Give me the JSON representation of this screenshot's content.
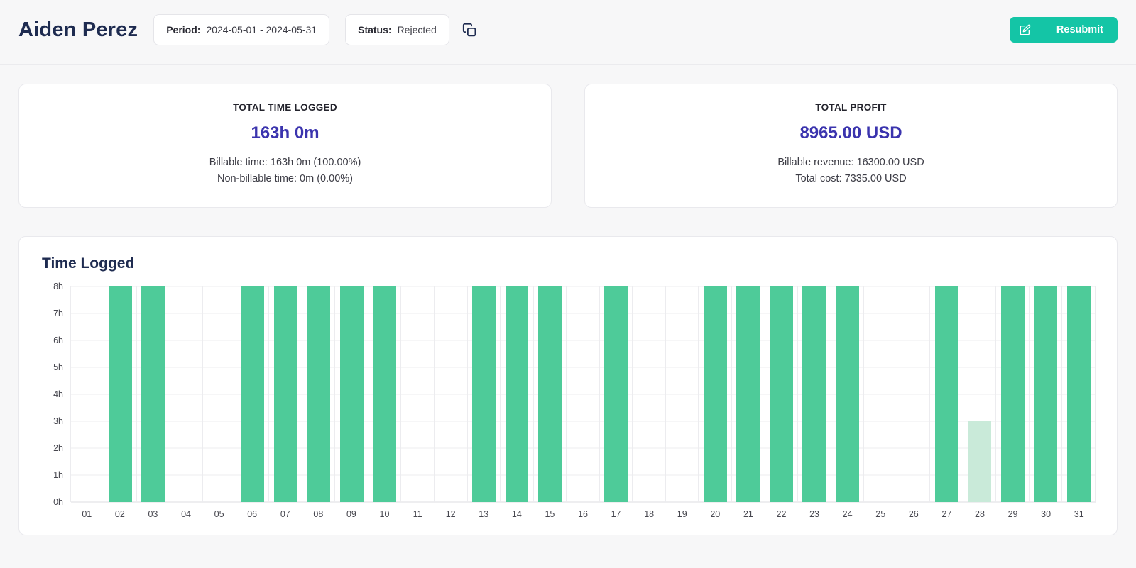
{
  "header": {
    "title": "Aiden Perez",
    "period_label": "Period:",
    "period_value": "2024-05-01 - 2024-05-31",
    "status_label": "Status:",
    "status_value": "Rejected",
    "resubmit_label": "Resubmit"
  },
  "cards": [
    {
      "title": "TOTAL TIME LOGGED",
      "value": "163h 0m",
      "line1": "Billable time: 163h 0m (100.00%)",
      "line2": "Non-billable time: 0m (0.00%)"
    },
    {
      "title": "TOTAL PROFIT",
      "value": "8965.00 USD",
      "line1": "Billable revenue: 16300.00 USD",
      "line2": "Total cost: 7335.00 USD"
    }
  ],
  "chart_data": {
    "type": "bar",
    "title": "Time Logged",
    "categories": [
      "01",
      "02",
      "03",
      "04",
      "05",
      "06",
      "07",
      "08",
      "09",
      "10",
      "11",
      "12",
      "13",
      "14",
      "15",
      "16",
      "17",
      "18",
      "19",
      "20",
      "21",
      "22",
      "23",
      "24",
      "25",
      "26",
      "27",
      "28",
      "29",
      "30",
      "31"
    ],
    "values": [
      0,
      8,
      8,
      0,
      0,
      8,
      8,
      8,
      8,
      8,
      0,
      0,
      8,
      8,
      8,
      0,
      8,
      0,
      0,
      8,
      8,
      8,
      8,
      8,
      0,
      0,
      8,
      3,
      8,
      8,
      8
    ],
    "xlabel": "",
    "ylabel": "",
    "ylim": [
      0,
      8
    ],
    "ytick_labels": [
      "0h",
      "1h",
      "2h",
      "3h",
      "4h",
      "5h",
      "6h",
      "7h",
      "8h"
    ],
    "grid": true,
    "bar_color": "#4ecb99",
    "muted_bar_color": "#c9ead9",
    "muted_categories": [
      "28"
    ]
  },
  "colors": {
    "accent_indigo": "#3b34ae",
    "button_teal": "#14c5a6",
    "title_navy": "#1e2b50",
    "page_background": "#f7f7f8"
  },
  "icons": {
    "copy": "copy-icon",
    "edit": "edit-icon"
  }
}
